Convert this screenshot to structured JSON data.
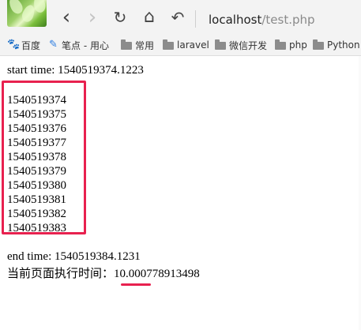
{
  "browser": {
    "url_host": "localhost",
    "url_path": "/test.php",
    "nav": {
      "back_icon": "‹",
      "forward_icon": "›",
      "reload_icon": "↻",
      "home_icon": "⌂",
      "undo_icon": "↶"
    }
  },
  "bookmarks": [
    {
      "label": "百度",
      "icon": "paw-icon"
    },
    {
      "label": "笔点 - 用心",
      "icon": "pen-icon"
    },
    {
      "label": "常用",
      "icon": "folder-icon"
    },
    {
      "label": "laravel",
      "icon": "folder-icon"
    },
    {
      "label": "微信开发",
      "icon": "folder-icon"
    },
    {
      "label": "php",
      "icon": "folder-icon"
    },
    {
      "label": "Python",
      "icon": "folder-icon"
    }
  ],
  "page": {
    "start_time": "start time: 1540519374.1223",
    "timestamps": [
      "1540519374",
      "1540519375",
      "1540519376",
      "1540519377",
      "1540519378",
      "1540519379",
      "1540519380",
      "1540519381",
      "1540519382",
      "1540519383"
    ],
    "end_time": "end time: 1540519384.1231",
    "exec_label": "当前页面执行时间：",
    "exec_value": "10.000778913498"
  },
  "colors": {
    "highlight": "#e8214f"
  }
}
